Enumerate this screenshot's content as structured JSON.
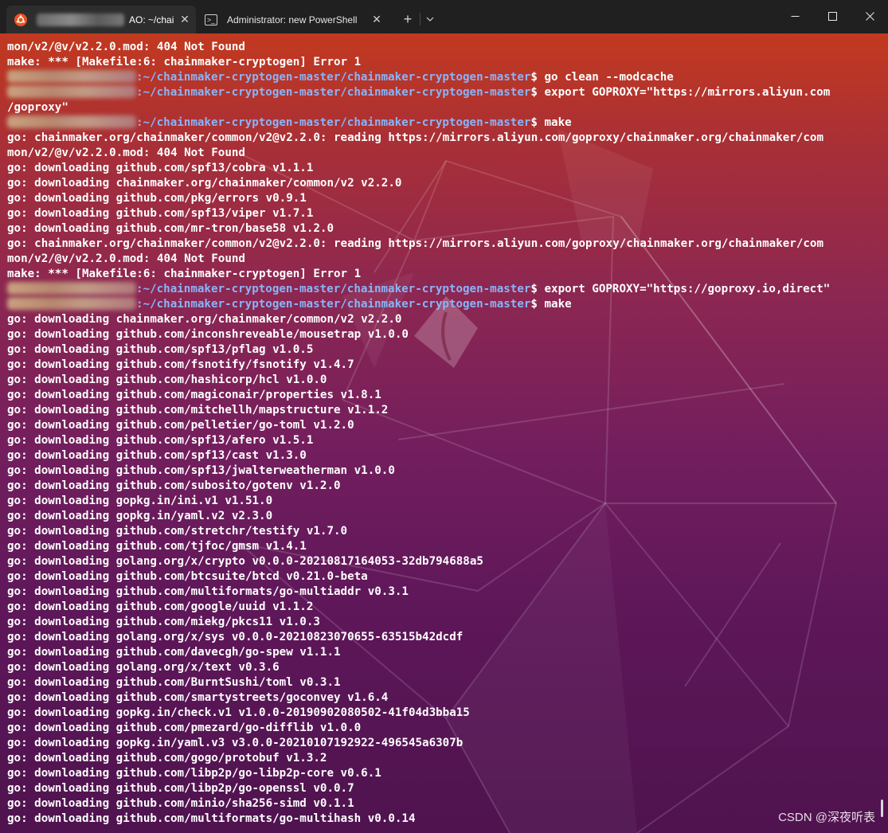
{
  "tabs": [
    {
      "title": "AO: ~/chai",
      "close": "✕",
      "icon": "ubuntu-icon"
    },
    {
      "title": "Administrator: new PowerShell",
      "close": "✕",
      "icon": "powershell-icon"
    }
  ],
  "tabbar": {
    "new_tab": "+",
    "dropdown": "⌵"
  },
  "window_controls": {
    "minimize": "—",
    "maximize": "☐",
    "close": "✕"
  },
  "prompt_path": ":~/chainmaker-cryptogen-master/chainmaker-cryptogen-master",
  "lines": [
    {
      "kind": "out",
      "text": "mon/v2/@v/v2.2.0.mod: 404 Not Found"
    },
    {
      "kind": "out",
      "text": "make: *** [Makefile:6: chainmaker-cryptogen] Error 1"
    },
    {
      "kind": "prompt",
      "cmd": " go clean --modcache"
    },
    {
      "kind": "prompt",
      "cmd": " export GOPROXY=\"https://mirrors.aliyun.com"
    },
    {
      "kind": "out",
      "text": "/goproxy\""
    },
    {
      "kind": "prompt",
      "cmd": " make"
    },
    {
      "kind": "out",
      "text": "go: chainmaker.org/chainmaker/common/v2@v2.2.0: reading https://mirrors.aliyun.com/goproxy/chainmaker.org/chainmaker/com"
    },
    {
      "kind": "out",
      "text": "mon/v2/@v/v2.2.0.mod: 404 Not Found"
    },
    {
      "kind": "out",
      "text": "go: downloading github.com/spf13/cobra v1.1.1"
    },
    {
      "kind": "out",
      "text": "go: downloading chainmaker.org/chainmaker/common/v2 v2.2.0"
    },
    {
      "kind": "out",
      "text": "go: downloading github.com/pkg/errors v0.9.1"
    },
    {
      "kind": "out",
      "text": "go: downloading github.com/spf13/viper v1.7.1"
    },
    {
      "kind": "out",
      "text": "go: downloading github.com/mr-tron/base58 v1.2.0"
    },
    {
      "kind": "out",
      "text": "go: chainmaker.org/chainmaker/common/v2@v2.2.0: reading https://mirrors.aliyun.com/goproxy/chainmaker.org/chainmaker/com"
    },
    {
      "kind": "out",
      "text": "mon/v2/@v/v2.2.0.mod: 404 Not Found"
    },
    {
      "kind": "out",
      "text": "make: *** [Makefile:6: chainmaker-cryptogen] Error 1"
    },
    {
      "kind": "prompt",
      "cmd": " export GOPROXY=\"https://goproxy.io,direct\""
    },
    {
      "kind": "prompt",
      "cmd": " make"
    },
    {
      "kind": "out",
      "text": "go: downloading chainmaker.org/chainmaker/common/v2 v2.2.0"
    },
    {
      "kind": "out",
      "text": "go: downloading github.com/inconshreveable/mousetrap v1.0.0"
    },
    {
      "kind": "out",
      "text": "go: downloading github.com/spf13/pflag v1.0.5"
    },
    {
      "kind": "out",
      "text": "go: downloading github.com/fsnotify/fsnotify v1.4.7"
    },
    {
      "kind": "out",
      "text": "go: downloading github.com/hashicorp/hcl v1.0.0"
    },
    {
      "kind": "out",
      "text": "go: downloading github.com/magiconair/properties v1.8.1"
    },
    {
      "kind": "out",
      "text": "go: downloading github.com/mitchellh/mapstructure v1.1.2"
    },
    {
      "kind": "out",
      "text": "go: downloading github.com/pelletier/go-toml v1.2.0"
    },
    {
      "kind": "out",
      "text": "go: downloading github.com/spf13/afero v1.5.1"
    },
    {
      "kind": "out",
      "text": "go: downloading github.com/spf13/cast v1.3.0"
    },
    {
      "kind": "out",
      "text": "go: downloading github.com/spf13/jwalterweatherman v1.0.0"
    },
    {
      "kind": "out",
      "text": "go: downloading github.com/subosito/gotenv v1.2.0"
    },
    {
      "kind": "out",
      "text": "go: downloading gopkg.in/ini.v1 v1.51.0"
    },
    {
      "kind": "out",
      "text": "go: downloading gopkg.in/yaml.v2 v2.3.0"
    },
    {
      "kind": "out",
      "text": "go: downloading github.com/stretchr/testify v1.7.0"
    },
    {
      "kind": "out",
      "text": "go: downloading github.com/tjfoc/gmsm v1.4.1"
    },
    {
      "kind": "out",
      "text": "go: downloading golang.org/x/crypto v0.0.0-20210817164053-32db794688a5"
    },
    {
      "kind": "out",
      "text": "go: downloading github.com/btcsuite/btcd v0.21.0-beta"
    },
    {
      "kind": "out",
      "text": "go: downloading github.com/multiformats/go-multiaddr v0.3.1"
    },
    {
      "kind": "out",
      "text": "go: downloading github.com/google/uuid v1.1.2"
    },
    {
      "kind": "out",
      "text": "go: downloading github.com/miekg/pkcs11 v1.0.3"
    },
    {
      "kind": "out",
      "text": "go: downloading golang.org/x/sys v0.0.0-20210823070655-63515b42dcdf"
    },
    {
      "kind": "out",
      "text": "go: downloading github.com/davecgh/go-spew v1.1.1"
    },
    {
      "kind": "out",
      "text": "go: downloading golang.org/x/text v0.3.6"
    },
    {
      "kind": "out",
      "text": "go: downloading github.com/BurntSushi/toml v0.3.1"
    },
    {
      "kind": "out",
      "text": "go: downloading github.com/smartystreets/goconvey v1.6.4"
    },
    {
      "kind": "out",
      "text": "go: downloading gopkg.in/check.v1 v1.0.0-20190902080502-41f04d3bba15"
    },
    {
      "kind": "out",
      "text": "go: downloading github.com/pmezard/go-difflib v1.0.0"
    },
    {
      "kind": "out",
      "text": "go: downloading gopkg.in/yaml.v3 v3.0.0-20210107192922-496545a6307b"
    },
    {
      "kind": "out",
      "text": "go: downloading github.com/gogo/protobuf v1.3.2"
    },
    {
      "kind": "out",
      "text": "go: downloading github.com/libp2p/go-libp2p-core v0.6.1"
    },
    {
      "kind": "out",
      "text": "go: downloading github.com/libp2p/go-openssl v0.0.7"
    },
    {
      "kind": "out",
      "text": "go: downloading github.com/minio/sha256-simd v0.1.1"
    },
    {
      "kind": "out",
      "text": "go: downloading github.com/multiformats/go-multihash v0.0.14"
    }
  ],
  "watermark": "CSDN @深夜听表",
  "colors": {
    "path": "#8ab4f8",
    "text": "#ffffff",
    "tab_active": "#2d2d2d",
    "titlebar": "#202020"
  }
}
